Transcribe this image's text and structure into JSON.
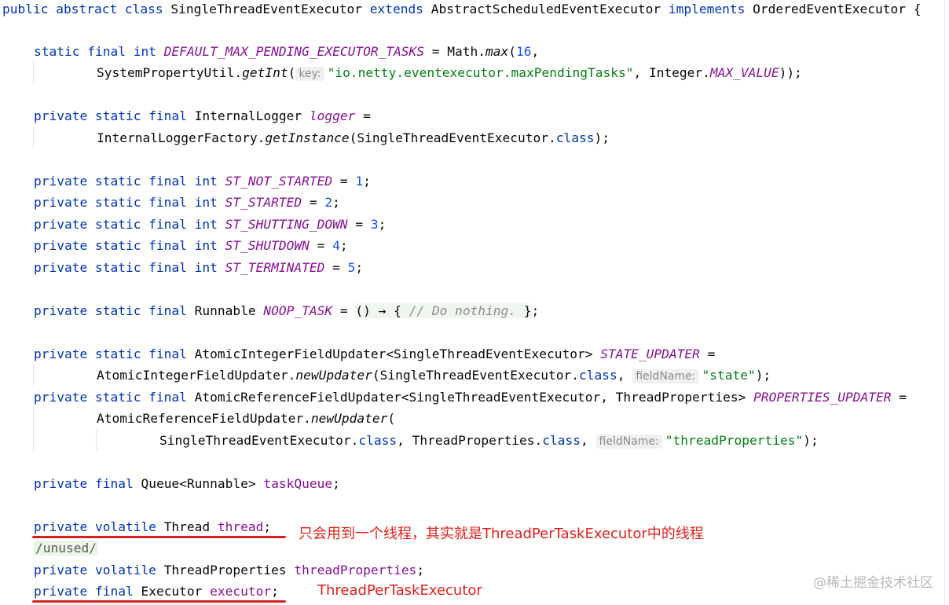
{
  "code": {
    "l1": {
      "kw1": "public abstract class ",
      "name": "SingleThreadEventExecutor ",
      "kw2": "extends ",
      "parent": "AbstractScheduledEventExecutor ",
      "kw3": "implements ",
      "iface": "OrderedEventExecutor {"
    },
    "l2": {
      "kw": "static final int ",
      "field": "DEFAULT_MAX_PENDING_EXECUTOR_TASKS",
      "op": " = Math.",
      "method": "max",
      "paren": "(",
      "num": "16",
      "tail": ","
    },
    "l3": {
      "cls": "SystemPropertyUtil.",
      "method": "getInt",
      "paren": "(",
      "hint": "key:",
      "str": "\"io.netty.eventexecutor.maxPendingTasks\"",
      "mid": ", Integer.",
      "field": "MAX_VALUE",
      "tail": "));"
    },
    "l4": {
      "kw": "private static final ",
      "type": "InternalLogger ",
      "field": "logger",
      "tail": " ="
    },
    "l5": {
      "cls": "InternalLoggerFactory.",
      "method": "getInstance",
      "mid": "(SingleThreadEventExecutor.",
      "kw": "class",
      "tail": ");"
    },
    "states": [
      {
        "kw": "private static final int ",
        "field": "ST_NOT_STARTED",
        "op": " = ",
        "num": "1",
        "tail": ";"
      },
      {
        "kw": "private static final int ",
        "field": "ST_STARTED",
        "op": " = ",
        "num": "2",
        "tail": ";"
      },
      {
        "kw": "private static final int ",
        "field": "ST_SHUTTING_DOWN",
        "op": " = ",
        "num": "3",
        "tail": ";"
      },
      {
        "kw": "private static final int ",
        "field": "ST_SHUTDOWN",
        "op": " = ",
        "num": "4",
        "tail": ";"
      },
      {
        "kw": "private static final int ",
        "field": "ST_TERMINATED",
        "op": " = ",
        "num": "5",
        "tail": ";"
      }
    ],
    "l11": {
      "kw": "private static final ",
      "type": "Runnable ",
      "field": "NOOP_TASK",
      "op": " = ",
      "lambda": "() → { ",
      "comment": "// Do nothing. ",
      "close": "}",
      "tail": ";"
    },
    "l12": {
      "kw": "private static final ",
      "type": "AtomicIntegerFieldUpdater<SingleThreadEventExecutor> ",
      "field": "STATE_UPDATER",
      "tail": " ="
    },
    "l13": {
      "cls": "AtomicIntegerFieldUpdater.",
      "method": "newUpdater",
      "mid": "(SingleThreadEventExecutor.",
      "kw": "class",
      "comma": ", ",
      "hint": "fieldName:",
      "str": "\"state\"",
      "tail": ");"
    },
    "l14": {
      "kw": "private static final ",
      "type": "AtomicReferenceFieldUpdater<SingleThreadEventExecutor, ThreadProperties> ",
      "field": "PROPERTIES_UPDATER",
      "tail": " ="
    },
    "l15": {
      "cls": "AtomicReferenceFieldUpdater.",
      "method": "newUpdater",
      "tail": "("
    },
    "l16": {
      "a": "SingleThreadEventExecutor.",
      "kw1": "class",
      "b": ", ThreadProperties.",
      "kw2": "class",
      "comma": ", ",
      "hint": "fieldName:",
      "str": "\"threadProperties\"",
      "tail": ");"
    },
    "l17": {
      "kw": "private final ",
      "type": "Queue<Runnable> ",
      "field": "taskQueue",
      "tail": ";"
    },
    "l18": {
      "kw": "private volatile ",
      "type": "Thread ",
      "field": "thread",
      "tail": ";"
    },
    "l19": {
      "text": "/unused/"
    },
    "l20": {
      "kw": "private volatile ",
      "type": "ThreadProperties ",
      "field": "threadProperties",
      "tail": ";"
    },
    "l21": {
      "kw": "private final ",
      "type": "Executor ",
      "field": "executor",
      "tail": ";"
    }
  },
  "annotations": {
    "thread_note": "只会用到一个线程，其实就是ThreadPerTaskExecutor中的线程",
    "executor_note": "ThreadPerTaskExecutor"
  },
  "watermark": "@稀土掘金技术社区",
  "colors": {
    "keyword": "#0033b3",
    "field": "#871094",
    "number": "#1750eb",
    "string": "#067d17",
    "comment": "#8c8c8c",
    "annotation": "#e0201b"
  }
}
